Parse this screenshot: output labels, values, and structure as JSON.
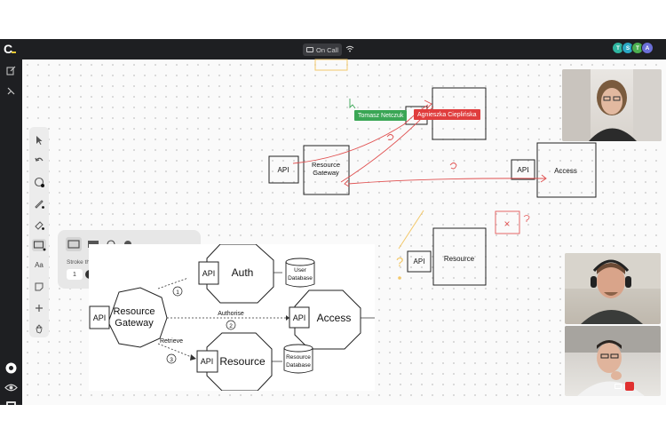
{
  "app": {
    "logo": "C"
  },
  "topbar": {
    "call_status": "On Call",
    "participants": [
      {
        "initial": "T",
        "color": "#2eb5a0"
      },
      {
        "initial": "S",
        "color": "#2aa8c4"
      },
      {
        "initial": "T",
        "color": "#4caf50"
      },
      {
        "initial": "A",
        "color": "#6b6fd8"
      }
    ]
  },
  "left_bar": {
    "items": [
      "edit-icon",
      "pointer-sketch-icon",
      "settings-icon",
      "eye-icon",
      "chat-icon"
    ]
  },
  "tools": {
    "items": [
      "select",
      "undo",
      "color-palette",
      "pen",
      "eraser",
      "shape",
      "text",
      "sticky-note",
      "add",
      "hand"
    ],
    "text_tool_label": "Aa",
    "active": "shape"
  },
  "stroke_popover": {
    "shapes": [
      "rectangle-outline",
      "rectangle-filled",
      "circle-outline",
      "circle-filled"
    ],
    "label": "Stroke thickness",
    "value": "1"
  },
  "whiteboard": {
    "nodes": [
      {
        "id": "api-left",
        "label": "API"
      },
      {
        "id": "resource-gateway",
        "label_line1": "Resource",
        "label_line2": "Gateway"
      },
      {
        "id": "api-access",
        "label": "API"
      },
      {
        "id": "access",
        "label": "Access"
      },
      {
        "id": "api-resource",
        "label": "API"
      },
      {
        "id": "resource",
        "label": "Resource"
      }
    ],
    "annotations": {
      "question_mark": "?",
      "x_mark": "×"
    },
    "cursors": [
      {
        "name": "Tomasz Netczuk",
        "color": "#3aa655"
      },
      {
        "name": "Agnieszka Cieplińska",
        "color": "#e03d3d"
      }
    ]
  },
  "pasted_diagram": {
    "nodes": {
      "api_gateway": "API",
      "gateway_line1": "Resource",
      "gateway_line2": "Gateway",
      "api_auth": "API",
      "auth": "Auth",
      "user_db_line1": "User",
      "user_db_line2": "Database",
      "api_access": "API",
      "access": "Access",
      "api_resource": "API",
      "resource": "Resource",
      "resource_db_line1": "Resource",
      "resource_db_line2": "Database"
    },
    "edges": {
      "authorise": "Authorise",
      "retrieve": "Retrieve",
      "step1": "1",
      "step2": "2",
      "step3": "3"
    }
  }
}
